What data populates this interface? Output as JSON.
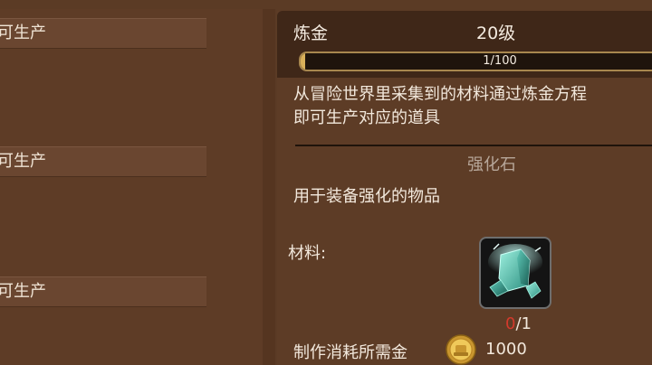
{
  "left": {
    "recipes": [
      {
        "label": "可生产"
      },
      {
        "label": "可生产"
      },
      {
        "label": "可生产"
      }
    ]
  },
  "skill": {
    "name": "炼金",
    "level": "20级",
    "xp_text": "1/100",
    "xp_fraction": 0.01
  },
  "description": {
    "line1": "从冒险世界里采集到的材料通过炼金方程",
    "line2": "即可生产对应的道具"
  },
  "item": {
    "name": "强化石",
    "description": "用于装备强化的物品"
  },
  "materials": {
    "label": "材料:",
    "icon": "teal-crystal-icon",
    "have": "0",
    "need": "/1",
    "have_color": "#d33a2c"
  },
  "cost": {
    "label": "制作消耗所需金",
    "icon": "gold-coin-icon",
    "value": "1000"
  }
}
